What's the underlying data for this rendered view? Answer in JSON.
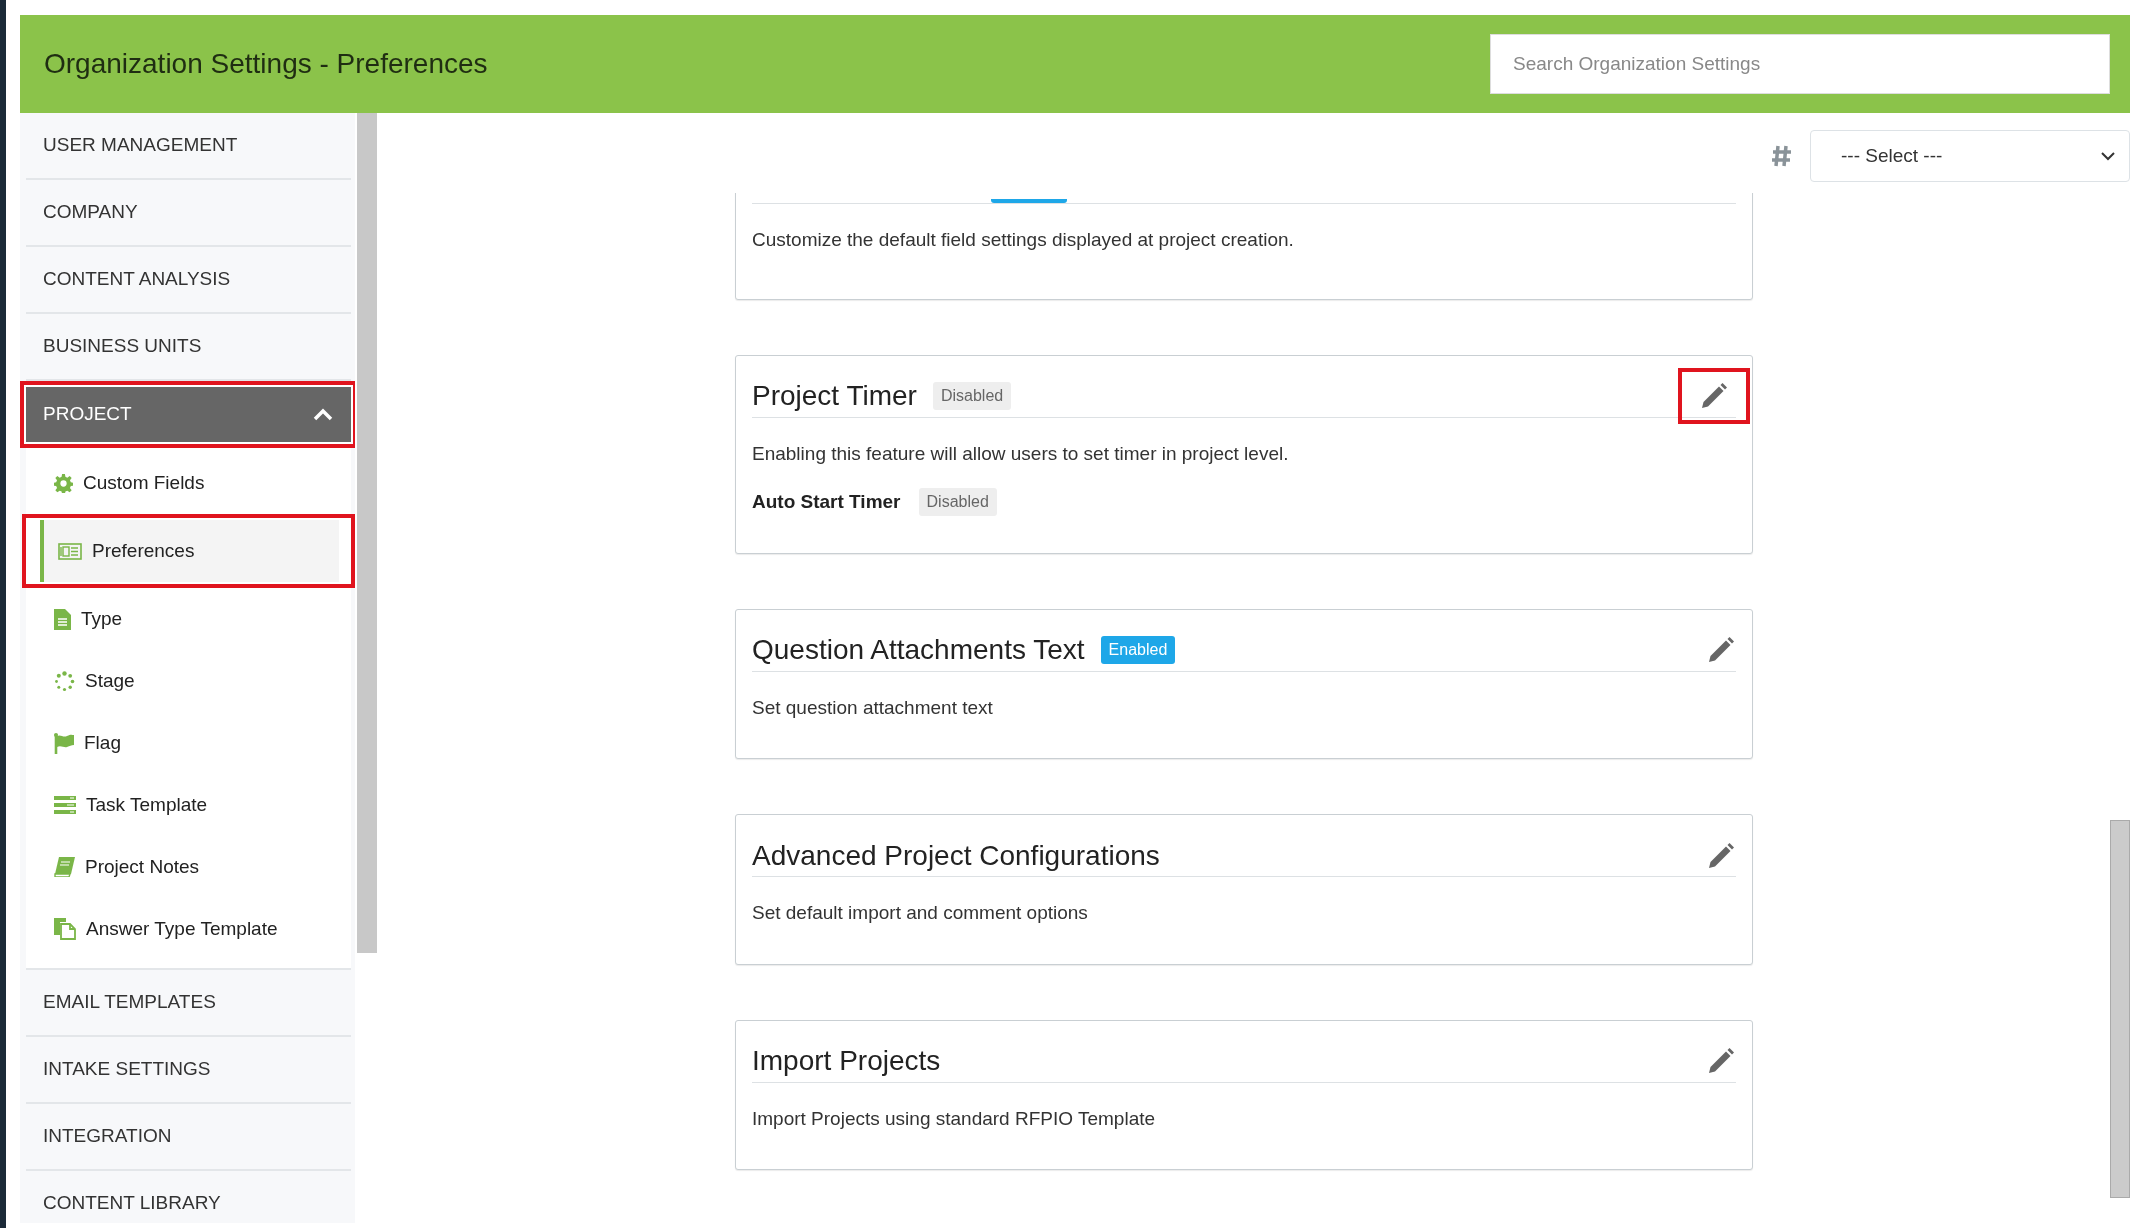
{
  "header": {
    "title": "Organization Settings - Preferences",
    "search": {
      "placeholder": "Search Organization Settings"
    }
  },
  "sidebar": {
    "items": [
      {
        "label": "USER MANAGEMENT",
        "expanded": false,
        "highlighted": false
      },
      {
        "label": "COMPANY",
        "expanded": false,
        "highlighted": false
      },
      {
        "label": "CONTENT ANALYSIS",
        "expanded": false,
        "highlighted": false
      },
      {
        "label": "BUSINESS UNITS",
        "expanded": false,
        "highlighted": false
      },
      {
        "label": "PROJECT",
        "expanded": true,
        "highlighted": true,
        "children": [
          {
            "label": "Custom Fields",
            "selected": false,
            "highlighted": false
          },
          {
            "label": "Preferences",
            "selected": true,
            "highlighted": true
          },
          {
            "label": "Type",
            "selected": false,
            "highlighted": false
          },
          {
            "label": "Stage",
            "selected": false,
            "highlighted": false
          },
          {
            "label": "Flag",
            "selected": false,
            "highlighted": false
          },
          {
            "label": "Task Template",
            "selected": false,
            "highlighted": false
          },
          {
            "label": "Project Notes",
            "selected": false,
            "highlighted": false
          },
          {
            "label": "Answer Type Template",
            "selected": false,
            "highlighted": false
          }
        ]
      },
      {
        "label": "EMAIL TEMPLATES",
        "expanded": false,
        "highlighted": false
      },
      {
        "label": "INTAKE SETTINGS",
        "expanded": false,
        "highlighted": false
      },
      {
        "label": "INTEGRATION",
        "expanded": false,
        "highlighted": false
      },
      {
        "label": "CONTENT LIBRARY",
        "expanded": false,
        "highlighted": false
      }
    ]
  },
  "toolbar": {
    "select": {
      "value": "--- Select ---"
    }
  },
  "cards": [
    {
      "enabled": true,
      "description": "Customize the default field settings displayed at project creation."
    },
    {
      "title": "Project Timer",
      "status": "Disabled",
      "enabled": false,
      "description": "Enabling this feature will allow users to set timer in project level.",
      "edit_highlighted": true,
      "settings": [
        {
          "label": "Auto Start Timer",
          "status": "Disabled",
          "enabled": false
        }
      ]
    },
    {
      "title": "Question Attachments Text",
      "status": "Enabled",
      "enabled": true,
      "description": "Set question attachment text",
      "edit_highlighted": false
    },
    {
      "title": "Advanced Project Configurations",
      "description": "Set default import and comment options",
      "edit_highlighted": false
    },
    {
      "title": "Import Projects",
      "description": "Import Projects using standard RFPIO Template",
      "edit_highlighted": false
    }
  ]
}
